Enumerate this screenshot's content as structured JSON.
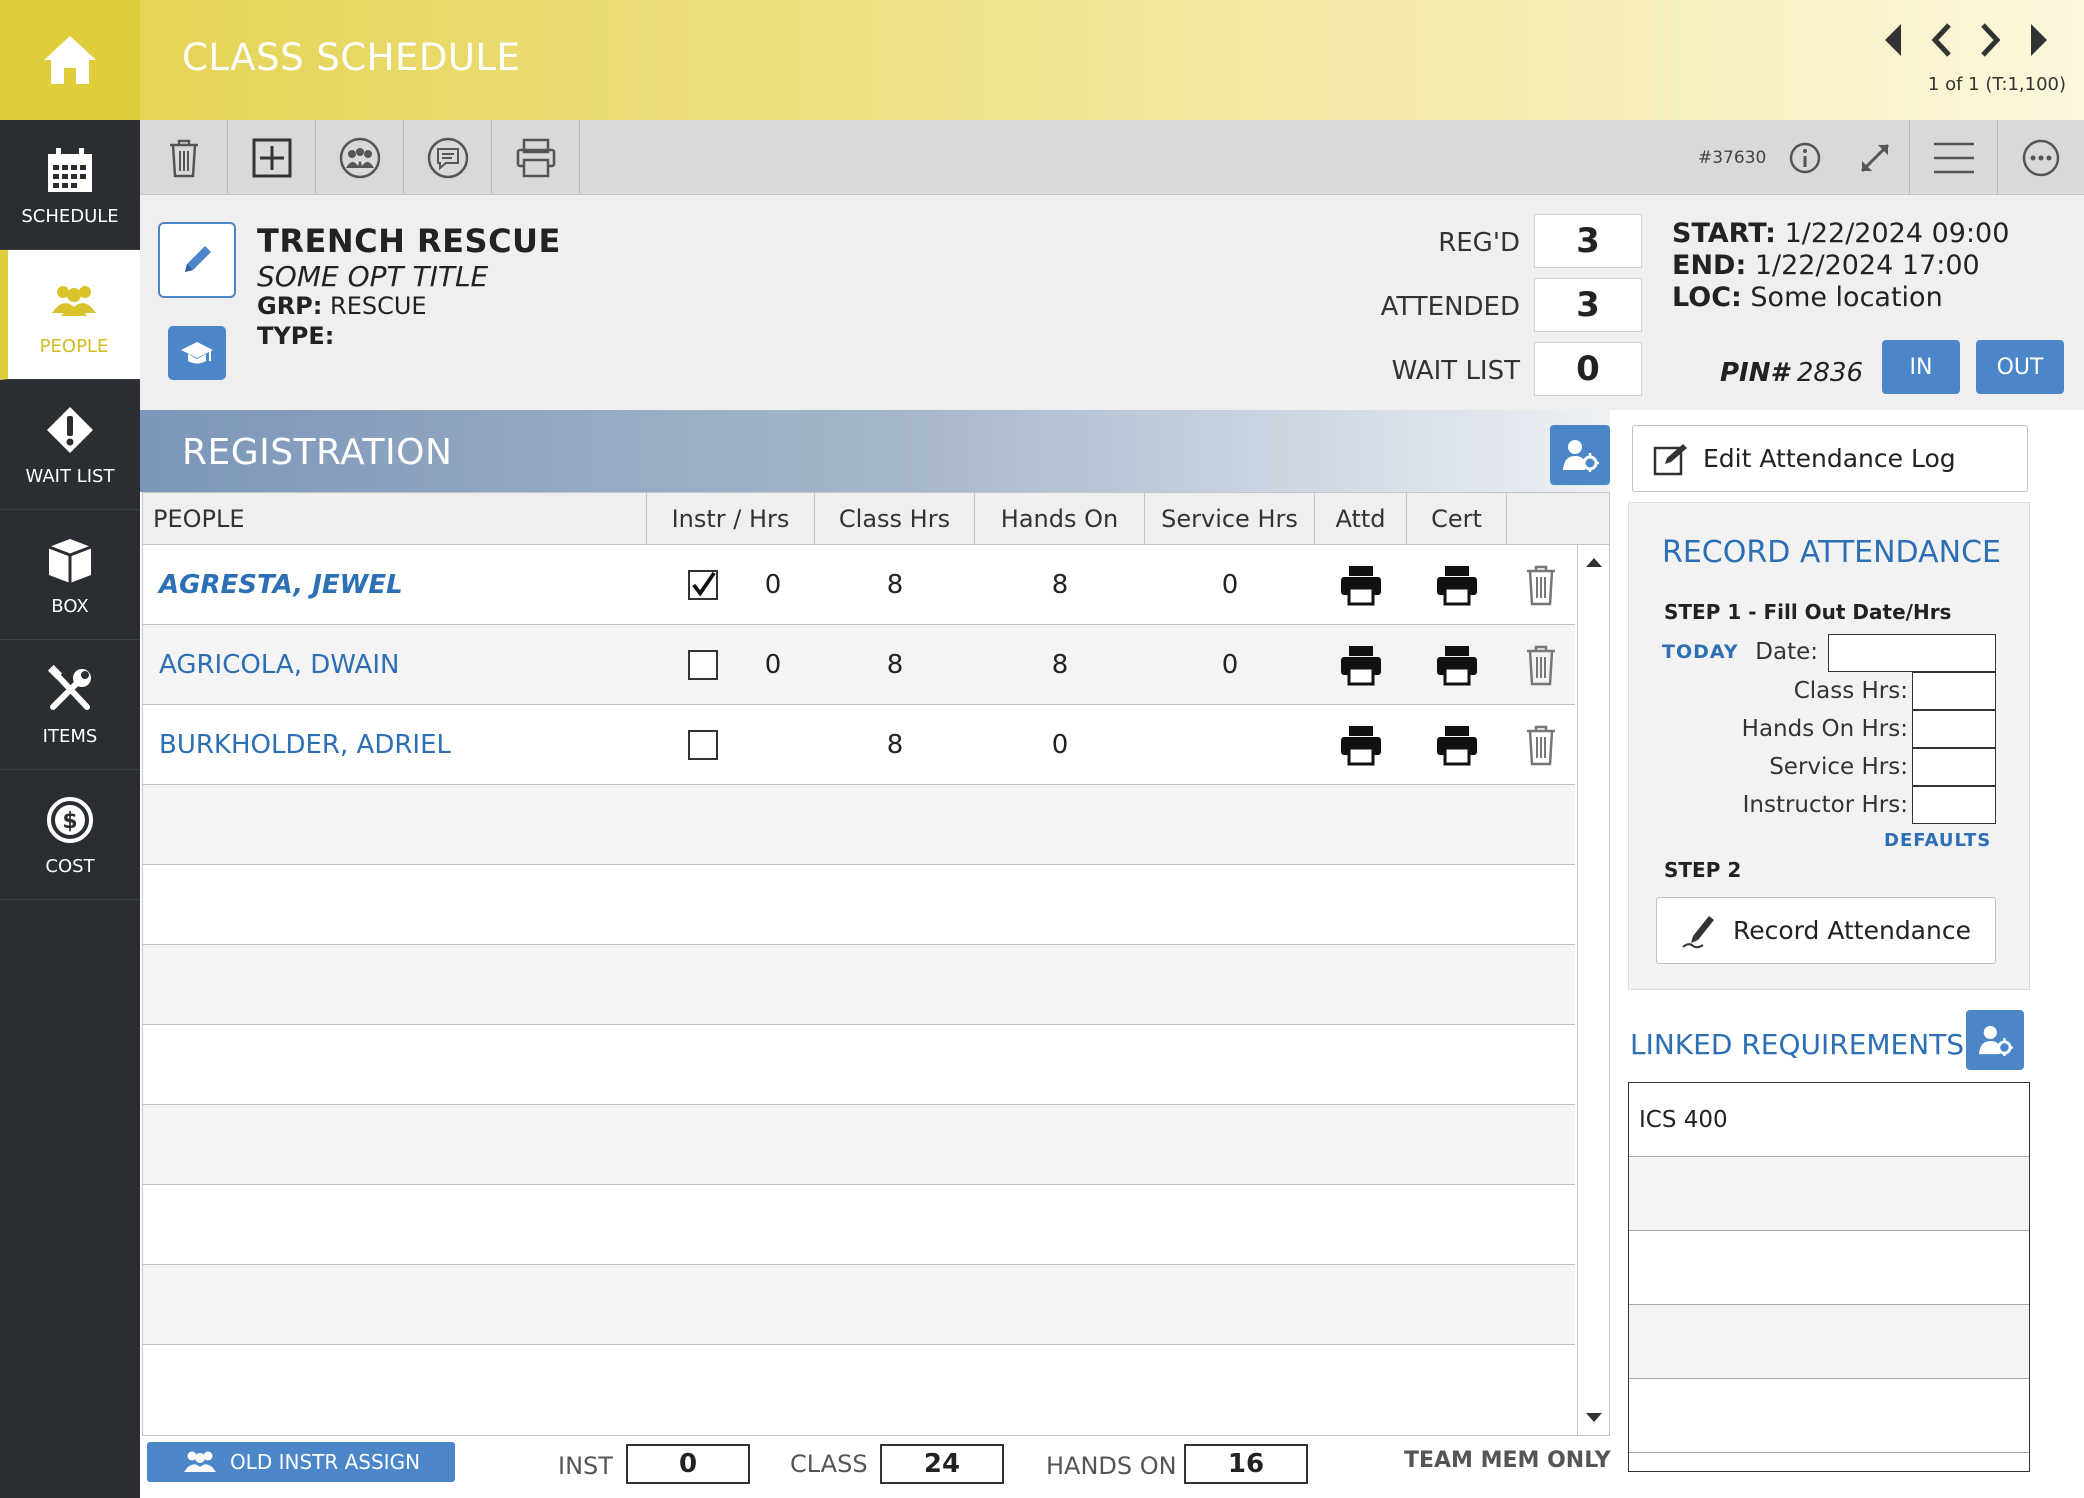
{
  "app": {
    "title": "CLASS SCHEDULE",
    "record_count": "1 of 1 (T:1,100)"
  },
  "sidebar": {
    "items": [
      {
        "label": "SCHEDULE",
        "icon": "calendar-icon"
      },
      {
        "label": "PEOPLE",
        "icon": "people-icon",
        "active": true
      },
      {
        "label": "WAIT LIST",
        "icon": "alert-icon"
      },
      {
        "label": "BOX",
        "icon": "box-icon"
      },
      {
        "label": "ITEMS",
        "icon": "tools-icon"
      },
      {
        "label": "COST",
        "icon": "dollar-icon"
      }
    ]
  },
  "toolbar": {
    "record_id": "#37630",
    "buttons": [
      "trash-icon",
      "add-icon",
      "group-icon",
      "chat-icon",
      "copy-icon"
    ],
    "right_buttons": [
      "info-icon",
      "expand-icon",
      "menu-icon",
      "more-icon"
    ]
  },
  "class_info": {
    "name": "TRENCH RESCUE",
    "subtitle": "SOME OPT TITLE",
    "grp_label": "GRP:",
    "grp_value": "RESCUE",
    "type_label": "TYPE:",
    "type_value": "",
    "regd_label": "REG'D",
    "regd_value": "3",
    "attended_label": "ATTENDED",
    "attended_value": "3",
    "waitlist_label": "WAIT LIST",
    "waitlist_value": "0",
    "start_label": "START:",
    "start_value": "1/22/2024 09:00",
    "end_label": "END:",
    "end_value": "1/22/2024 17:00",
    "loc_label": "LOC:",
    "loc_value": "Some location",
    "pin_label": "PIN#",
    "pin_value": "2836",
    "in_label": "IN",
    "out_label": "OUT"
  },
  "registration": {
    "title": "REGISTRATION",
    "columns": [
      "PEOPLE",
      "Instr / Hrs",
      "Class Hrs",
      "Hands On",
      "Service Hrs",
      "Attd",
      "Cert"
    ],
    "rows": [
      {
        "name": "AGRESTA, JEWEL",
        "selected": true,
        "instr_checked": true,
        "instr_hrs": "0",
        "class_hrs": "8",
        "hands_on": "8",
        "service_hrs": "0"
      },
      {
        "name": "AGRICOLA, DWAIN",
        "selected": false,
        "instr_checked": false,
        "instr_hrs": "0",
        "class_hrs": "8",
        "hands_on": "8",
        "service_hrs": "0"
      },
      {
        "name": "BURKHOLDER, ADRIEL",
        "selected": false,
        "instr_checked": false,
        "instr_hrs": "",
        "class_hrs": "8",
        "hands_on": "0",
        "service_hrs": ""
      }
    ]
  },
  "footer": {
    "old_instr_label": "OLD INSTR ASSIGN",
    "inst_label": "INST",
    "inst_value": "0",
    "class_label": "CLASS",
    "class_value": "24",
    "hands_on_label": "HANDS ON",
    "hands_on_value": "16",
    "team_only": "TEAM MEM ONLY"
  },
  "attendance": {
    "edit_log_label": "Edit Attendance Log",
    "title": "RECORD ATTENDANCE",
    "step1": "STEP 1 - Fill Out Date/Hrs",
    "today_label": "TODAY",
    "date_label": "Date:",
    "class_hrs_label": "Class Hrs:",
    "hands_on_label": "Hands On Hrs:",
    "service_label": "Service Hrs:",
    "instructor_label": "Instructor Hrs:",
    "defaults_label": "DEFAULTS",
    "step2": "STEP 2",
    "record_btn": "Record Attendance"
  },
  "linked": {
    "title": "LINKED REQUIREMENTS",
    "items": [
      "ICS 400",
      "",
      "",
      "",
      ""
    ]
  },
  "colors": {
    "accent_yellow": "#e0cd3c",
    "accent_blue": "#4a86c8",
    "link_blue": "#2d6fb4",
    "sidebar_dark": "#2a2e33"
  }
}
